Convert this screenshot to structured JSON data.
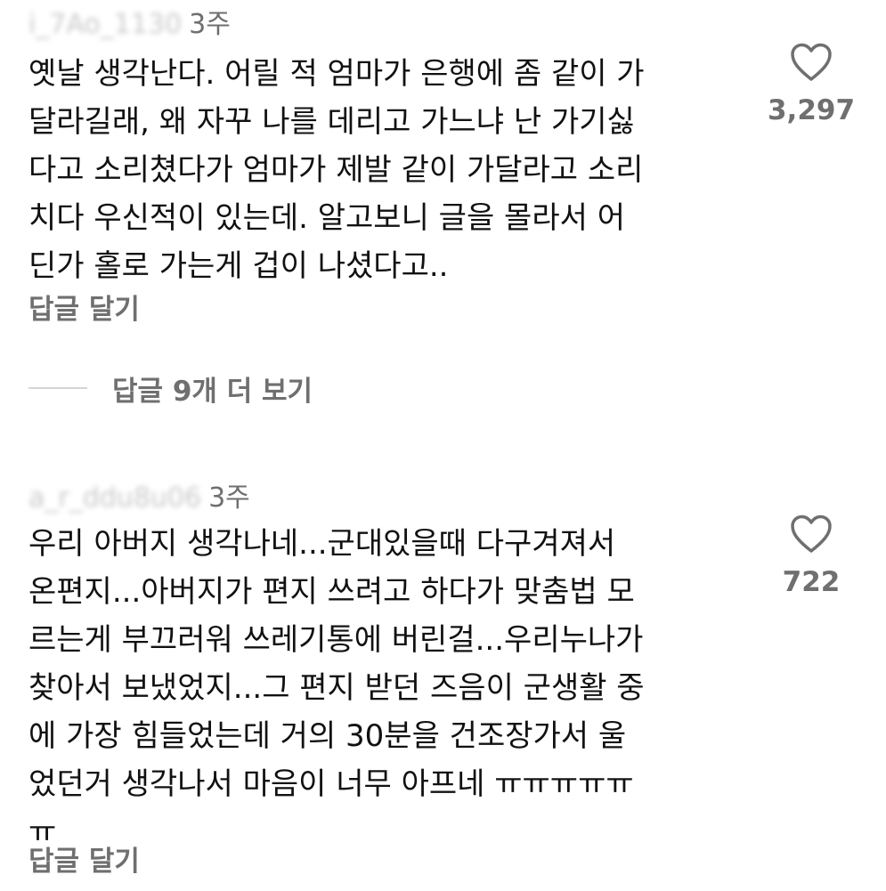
{
  "comments": [
    {
      "username": "i_7Ao_1130",
      "time": "3주",
      "lines": [
        "옛날 생각난다. 어릴 적 엄마가 은행에 좀 같이 가",
        "달라길래, 왜 자꾸 나를 데리고 가느냐 난 가기싫",
        "다고 소리쳤다가 엄마가 제발 같이 가달라고 소리",
        "치다 우신적이 있는데. 알고보니 글을 몰라서 어",
        "딘가 홀로 가는게 겁이 나셨다고.."
      ],
      "likes": "3,297",
      "reply_label": "답글 달기",
      "more_replies_label": "답글 9개 더 보기"
    },
    {
      "username": "a_r_ddu8u06",
      "time": "3주",
      "lines": [
        "우리 아버지 생각나네...군대있을때 다구겨져서",
        "온편지...아버지가 편지 쓰려고 하다가 맞춤법 모",
        "르는게 부끄러워 쓰레기통에 버린걸...우리누나가",
        "찾아서 보냈었지...그 편지 받던 즈음이 군생활 중",
        "에 가장 힘들었는데 거의 30분을 건조장가서 울",
        "었던거 생각나서 마음이 너무 아프네 ㅠㅠㅠㅠㅠ",
        "ㅠ"
      ],
      "likes": "722",
      "reply_label": "답글 달기"
    }
  ],
  "icons": {
    "like": "heart-outline-icon"
  },
  "colors": {
    "text": "#111111",
    "secondary": "#6f6f6f",
    "divider": "#d5d5d5",
    "background": "#ffffff"
  }
}
